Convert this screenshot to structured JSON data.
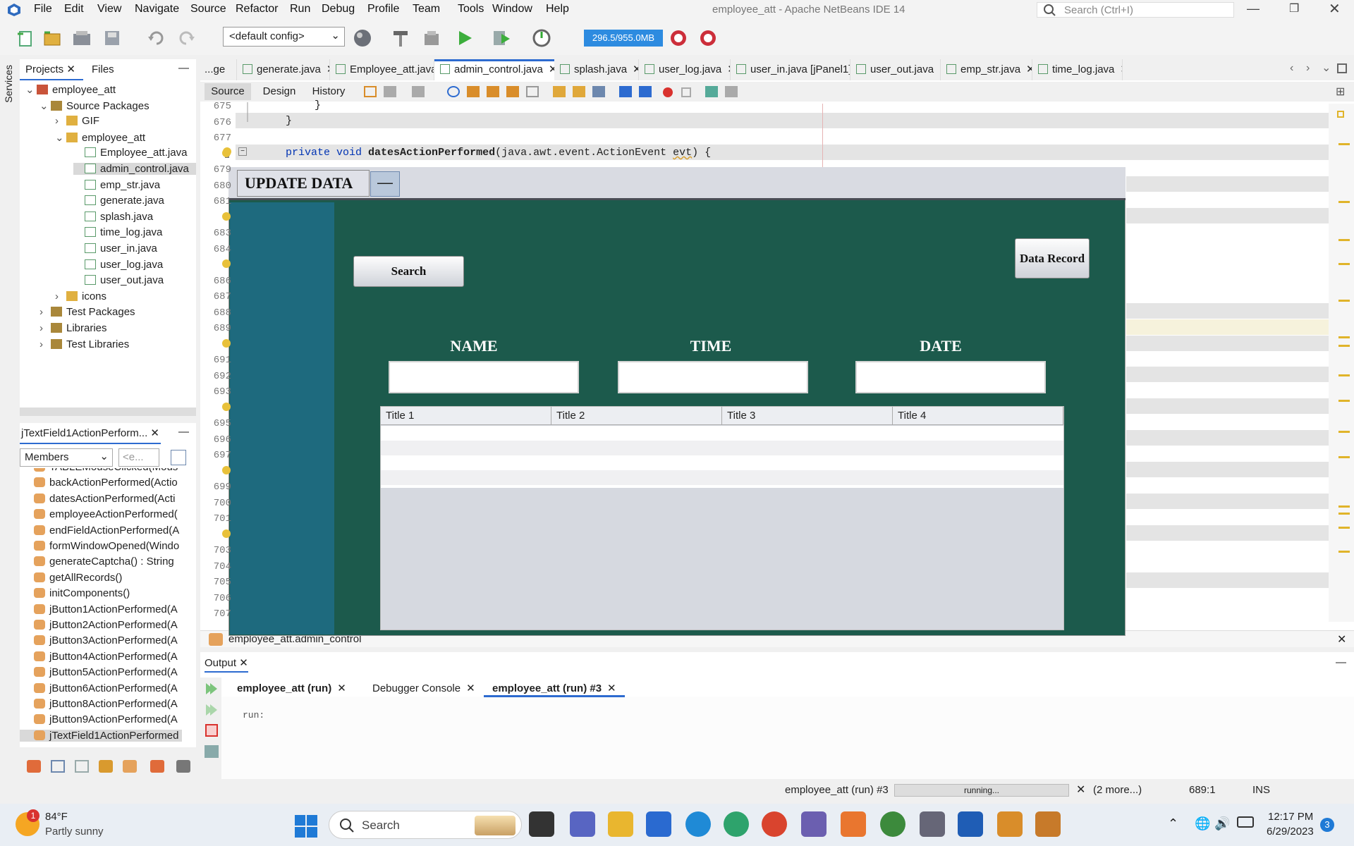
{
  "window": {
    "title": "employee_att - Apache NetBeans IDE 14",
    "search_placeholder": "Search (Ctrl+I)"
  },
  "menu": [
    "File",
    "Edit",
    "View",
    "Navigate",
    "Source",
    "Refactor",
    "Run",
    "Debug",
    "Profile",
    "Team",
    "Tools",
    "Window",
    "Help"
  ],
  "toolbar": {
    "config": "<default config>",
    "memory": "296.5/955.0MB"
  },
  "projects": {
    "tab": "Projects",
    "files_tab": "Files",
    "services_tab": "Services",
    "tree": [
      {
        "label": "employee_att",
        "level": 0
      },
      {
        "label": "Source Packages",
        "level": 1
      },
      {
        "label": "GIF",
        "level": 2
      },
      {
        "label": "employee_att",
        "level": 2
      },
      {
        "label": "Employee_att.java",
        "level": 3
      },
      {
        "label": "admin_control.java",
        "level": 3
      },
      {
        "label": "emp_str.java",
        "level": 3
      },
      {
        "label": "generate.java",
        "level": 3
      },
      {
        "label": "splash.java",
        "level": 3
      },
      {
        "label": "time_log.java",
        "level": 3
      },
      {
        "label": "user_in.java",
        "level": 3
      },
      {
        "label": "user_log.java",
        "level": 3
      },
      {
        "label": "user_out.java",
        "level": 3
      },
      {
        "label": "icons",
        "level": 2
      },
      {
        "label": "Test Packages",
        "level": 1
      },
      {
        "label": "Libraries",
        "level": 1
      },
      {
        "label": "Test Libraries",
        "level": 1
      }
    ]
  },
  "navigator": {
    "tab": "jTextField1ActionPerform...",
    "filter": "Members",
    "filter2": "<e...",
    "members": [
      "TABLEMouseClicked(Mous",
      "backActionPerformed(Actio",
      "datesActionPerformed(Acti",
      "employeeActionPerformed(",
      "endFieldActionPerformed(A",
      "formWindowOpened(Windo",
      "generateCaptcha() : String",
      "getAllRecords()",
      "initComponents()",
      "jButton1ActionPerformed(A",
      "jButton2ActionPerformed(A",
      "jButton3ActionPerformed(A",
      "jButton4ActionPerformed(A",
      "jButton5ActionPerformed(A",
      "jButton6ActionPerformed(A",
      "jButton8ActionPerformed(A",
      "jButton9ActionPerformed(A",
      "jTextField1ActionPerformed"
    ]
  },
  "tabs": [
    "...ge",
    "generate.java",
    "Employee_att.java",
    "admin_control.java",
    "splash.java",
    "user_log.java",
    "user_in.java [jPanel1]",
    "user_out.java",
    "emp_str.java",
    "time_log.java"
  ],
  "editor_tabs": {
    "source": "Source",
    "design": "Design",
    "history": "History"
  },
  "gutter": [
    "675",
    "676",
    "677",
    "",
    "679",
    "680",
    "681",
    "",
    "683",
    "684",
    "",
    "686",
    "687",
    "688",
    "689",
    "",
    "691",
    "692",
    "693",
    "",
    "695",
    "696",
    "697",
    "",
    "699",
    "700",
    "701",
    "",
    "703",
    "704",
    "705",
    "706",
    "707"
  ],
  "code": {
    "l675": "}",
    "l676": "}",
    "l678a": "private void",
    "l678b": "datesActionPerformed",
    "l678c": "(java.awt.event.ActionEvent",
    "l678d": "evt",
    "l678e": ") {"
  },
  "breadcrumb": "employee_att.admin_control",
  "dialog": {
    "title": "UPDATE DATA",
    "minimize": "—",
    "search_btn": "Search",
    "record_btn": "Data Record",
    "labels": [
      "NAME",
      "TIME",
      "DATE"
    ],
    "columns": [
      "Title 1",
      "Title 2",
      "Title 3",
      "Title 4"
    ]
  },
  "output": {
    "title": "Output",
    "tabs": [
      "employee_att (run)",
      "Debugger Console",
      "employee_att (run) #3"
    ],
    "text": "run:"
  },
  "status": {
    "task": "employee_att (run) #3",
    "progress": "running...",
    "more": "(2 more...)",
    "pos": "689:1",
    "mode": "INS"
  },
  "taskbar": {
    "temp": "84°F",
    "weather": "Partly sunny",
    "search": "Search",
    "time": "12:17 PM",
    "date": "6/29/2023",
    "badge": "3",
    "weather_badge": "1"
  }
}
